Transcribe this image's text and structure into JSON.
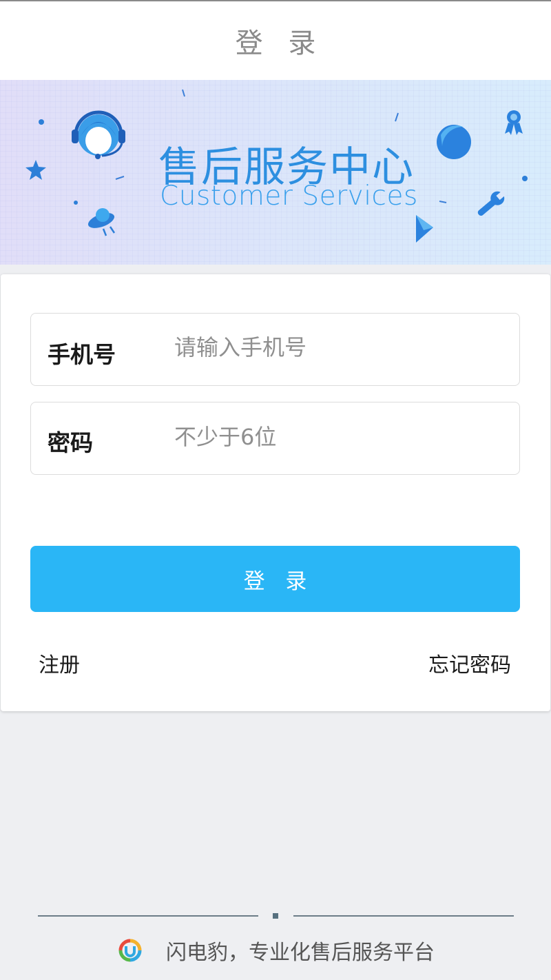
{
  "nav": {
    "title": "登 录"
  },
  "banner": {
    "title": "售后服务中心",
    "subtitle": "Customer Services"
  },
  "form": {
    "phone": {
      "label": "手机号",
      "placeholder": "请输入手机号",
      "value": ""
    },
    "password": {
      "label": "密码",
      "placeholder": "不少于6位",
      "value": ""
    },
    "login_label": "登 录",
    "register_label": "注册",
    "forgot_label": "忘记密码"
  },
  "footer": {
    "text": "闪电豹，专业化售后服务平台"
  },
  "colors": {
    "accent": "#2ab6f6",
    "banner_blue": "#2d8fe0",
    "background": "#eeeff2"
  },
  "icons": [
    "headset-avatar-icon",
    "star-icon",
    "ufo-icon",
    "planet-icon",
    "award-ribbon-icon",
    "wrench-icon",
    "triangle-shape-icon",
    "brand-logo-icon"
  ]
}
